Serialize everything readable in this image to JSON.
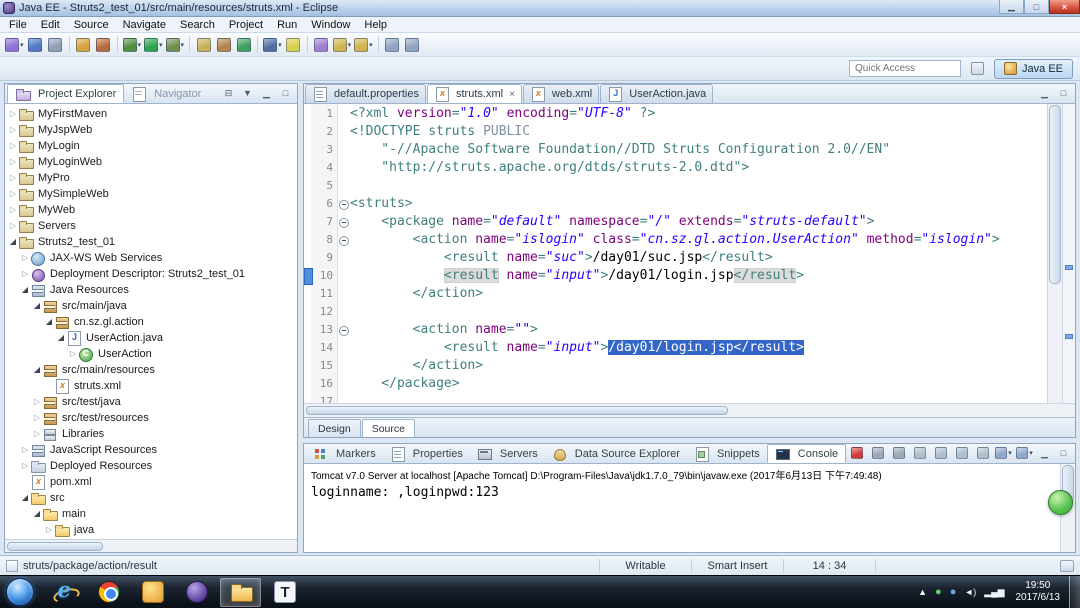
{
  "colors": {
    "syntax-tag": "#3f7f7f",
    "syntax-attr": "#7f007f",
    "syntax-value": "#2a00ff",
    "syntax-doctype": "#3f7f7f",
    "syntax-public": "#7f8fa0",
    "selection-bg": "#3465c8",
    "occurrence-bg": "#dcdcdc",
    "marker-blue": "#4f8fdf",
    "bubble-green": "#3fae3f"
  },
  "titlebar": {
    "title": "Java EE - Struts2_test_01/src/main/resources/struts.xml - Eclipse",
    "window_buttons": [
      "minimize",
      "maximize",
      "close"
    ]
  },
  "menubar": {
    "items": [
      "File",
      "Edit",
      "Source",
      "Navigate",
      "Search",
      "Project",
      "Run",
      "Window",
      "Help"
    ]
  },
  "toolbar": {
    "quick_access_placeholder": "Quick Access",
    "perspective_label": "Java EE",
    "groups": [
      [
        {
          "n": "new",
          "c": "#8e6fd8",
          "dd": true
        },
        {
          "n": "save",
          "c": "#4f79c8"
        },
        {
          "n": "print",
          "c": "#8fa0b4"
        }
      ],
      [
        {
          "n": "new-servlet",
          "c": "#d8a23c"
        },
        {
          "n": "new-ejb",
          "c": "#b86c3c"
        }
      ],
      [
        {
          "n": "debug",
          "c": "#4f8f3f",
          "dd": true
        },
        {
          "n": "run",
          "c": "#2fa44f",
          "dd": true
        },
        {
          "n": "external-tools",
          "c": "#6f8f4f",
          "dd": true
        }
      ],
      [
        {
          "n": "new-java-project",
          "c": "#c8b05a"
        },
        {
          "n": "new-package",
          "c": "#b4824f"
        },
        {
          "n": "new-class",
          "c": "#3fa05f"
        }
      ],
      [
        {
          "n": "search",
          "c": "#4f6f9f",
          "dd": true
        },
        {
          "n": "toggle-mark-occurrences",
          "c": "#d8d04f"
        }
      ],
      [
        {
          "n": "last-edit-location",
          "c": "#9f7fd0"
        },
        {
          "n": "back",
          "c": "#d0b44f",
          "dd": true
        },
        {
          "n": "forward",
          "c": "#d0b44f",
          "dd": true
        }
      ],
      [
        {
          "n": "next-annotation",
          "c": "#8fa4c0"
        },
        {
          "n": "previous-annotation",
          "c": "#8fa4c0"
        }
      ]
    ]
  },
  "explorer": {
    "tab_active": "Project Explorer",
    "tab_inactive": "Navigator",
    "tools": [
      "collapse-all",
      "view-menu",
      "minimize",
      "maximize"
    ],
    "tree": [
      {
        "label": "MyFirstMaven",
        "d": 0,
        "a": "c",
        "icon": "mproject"
      },
      {
        "label": "MyJspWeb",
        "d": 0,
        "a": "c",
        "icon": "wproject"
      },
      {
        "label": "MyLogin",
        "d": 0,
        "a": "c",
        "icon": "wproject"
      },
      {
        "label": "MyLoginWeb",
        "d": 0,
        "a": "c",
        "icon": "wproject"
      },
      {
        "label": "MyPro",
        "d": 0,
        "a": "c",
        "icon": "wproject"
      },
      {
        "label": "MySimpleWeb",
        "d": 0,
        "a": "c",
        "icon": "wproject"
      },
      {
        "label": "MyWeb",
        "d": 0,
        "a": "c",
        "icon": "wproject"
      },
      {
        "label": "Servers",
        "d": 0,
        "a": "c",
        "icon": "sproject"
      },
      {
        "label": "Struts2_test_01",
        "d": 0,
        "a": "e",
        "icon": "wproject"
      },
      {
        "label": "JAX-WS Web Services",
        "d": 1,
        "a": "c",
        "icon": "jaxws"
      },
      {
        "label": "Deployment Descriptor: Struts2_test_01",
        "d": 1,
        "a": "c",
        "icon": "dd"
      },
      {
        "label": "Java Resources",
        "d": 1,
        "a": "e",
        "icon": "jres"
      },
      {
        "label": "src/main/java",
        "d": 2,
        "a": "e",
        "icon": "srcpkg"
      },
      {
        "label": "cn.sz.gl.action",
        "d": 3,
        "a": "e",
        "icon": "pkg"
      },
      {
        "label": "UserAction.java",
        "d": 4,
        "a": "e",
        "icon": "jfile"
      },
      {
        "label": "UserAction",
        "d": 5,
        "a": "c",
        "icon": "cls"
      },
      {
        "label": "src/main/resources",
        "d": 2,
        "a": "e",
        "icon": "srcpkg"
      },
      {
        "label": "struts.xml",
        "d": 3,
        "a": "n",
        "icon": "xfile"
      },
      {
        "label": "src/test/java",
        "d": 2,
        "a": "c",
        "icon": "srcpkg"
      },
      {
        "label": "src/test/resources",
        "d": 2,
        "a": "c",
        "icon": "srcpkg"
      },
      {
        "label": "Libraries",
        "d": 2,
        "a": "c",
        "icon": "lib"
      },
      {
        "label": "JavaScript Resources",
        "d": 1,
        "a": "c",
        "icon": "jsres"
      },
      {
        "label": "Deployed Resources",
        "d": 1,
        "a": "c",
        "icon": "dres"
      },
      {
        "label": "pom.xml",
        "d": 1,
        "a": "n",
        "icon": "xfile"
      },
      {
        "label": "src",
        "d": 1,
        "a": "e",
        "icon": "folder"
      },
      {
        "label": "main",
        "d": 2,
        "a": "e",
        "icon": "folder"
      },
      {
        "label": "java",
        "d": 3,
        "a": "c",
        "icon": "folder"
      }
    ]
  },
  "editor": {
    "tabs": [
      {
        "label": "default.properties",
        "icon": "properties",
        "active": false
      },
      {
        "label": "struts.xml",
        "icon": "xml",
        "active": true
      },
      {
        "label": "web.xml",
        "icon": "xml",
        "active": false
      },
      {
        "label": "UserAction.java",
        "icon": "java",
        "active": false
      }
    ],
    "tools": [
      "minimize",
      "maximize"
    ],
    "view_tabs": [
      "Design",
      "Source"
    ],
    "active_view_tab": "Source",
    "lines": [
      {
        "n": 1,
        "s": [
          [
            "tag",
            "<?xml "
          ],
          [
            "attr",
            "version"
          ],
          [
            "tag",
            "="
          ],
          [
            "val",
            "\"1.0\""
          ],
          [
            "txt",
            " "
          ],
          [
            "attr",
            "encoding"
          ],
          [
            "tag",
            "="
          ],
          [
            "val",
            "\"UTF-8\""
          ],
          [
            "tag",
            " ?>"
          ]
        ]
      },
      {
        "n": 2,
        "s": [
          [
            "tag",
            "<!DOCTYPE struts "
          ],
          [
            "pub",
            "PUBLIC"
          ]
        ]
      },
      {
        "n": 3,
        "s": [
          [
            "dtd",
            "    \"-//Apache Software Foundation//DTD Struts Configuration 2.0//EN\""
          ]
        ]
      },
      {
        "n": 4,
        "s": [
          [
            "dtd",
            "    \"http://struts.apache.org/dtds/struts-2.0.dtd\""
          ],
          [
            "tag",
            ">"
          ]
        ]
      },
      {
        "n": 5,
        "s": []
      },
      {
        "n": 6,
        "f": true,
        "s": [
          [
            "tag",
            "<struts>"
          ]
        ]
      },
      {
        "n": 7,
        "f": true,
        "s": [
          [
            "tag",
            "    <package "
          ],
          [
            "attr",
            "name"
          ],
          [
            "tag",
            "="
          ],
          [
            "val",
            "\"default\""
          ],
          [
            "txt",
            " "
          ],
          [
            "attr",
            "namespace"
          ],
          [
            "tag",
            "="
          ],
          [
            "val",
            "\"/\""
          ],
          [
            "txt",
            " "
          ],
          [
            "attr",
            "extends"
          ],
          [
            "tag",
            "="
          ],
          [
            "val",
            "\"struts-default\""
          ],
          [
            "tag",
            ">"
          ]
        ]
      },
      {
        "n": 8,
        "f": true,
        "s": [
          [
            "tag",
            "        <action "
          ],
          [
            "attr",
            "name"
          ],
          [
            "tag",
            "="
          ],
          [
            "val",
            "\"islogin\""
          ],
          [
            "txt",
            " "
          ],
          [
            "attr",
            "class"
          ],
          [
            "tag",
            "="
          ],
          [
            "val",
            "\"cn.sz.gl.action.UserAction\""
          ],
          [
            "txt",
            " "
          ],
          [
            "attr",
            "method"
          ],
          [
            "tag",
            "="
          ],
          [
            "val",
            "\"islogin\""
          ],
          [
            "tag",
            ">"
          ]
        ]
      },
      {
        "n": 9,
        "s": [
          [
            "tag",
            "            <result "
          ],
          [
            "attr",
            "name"
          ],
          [
            "tag",
            "="
          ],
          [
            "val",
            "\"suc\""
          ],
          [
            "tag",
            ">"
          ],
          [
            "txt",
            "/day01/suc.jsp"
          ],
          [
            "tag",
            "</result>"
          ]
        ]
      },
      {
        "n": 10,
        "m": true,
        "s": [
          [
            "tag",
            "            "
          ],
          [
            "tago",
            "<result"
          ],
          [
            "tag",
            " "
          ],
          [
            "attr",
            "name"
          ],
          [
            "tag",
            "="
          ],
          [
            "val",
            "\"input\""
          ],
          [
            "tag",
            ">"
          ],
          [
            "txt",
            "/day01/login.jsp"
          ],
          [
            "tago",
            "</result"
          ],
          [
            "tag",
            ">"
          ]
        ]
      },
      {
        "n": 11,
        "s": [
          [
            "tag",
            "        </action>"
          ]
        ]
      },
      {
        "n": 12,
        "s": []
      },
      {
        "n": 13,
        "f": true,
        "s": [
          [
            "tag",
            "        <action "
          ],
          [
            "attr",
            "name"
          ],
          [
            "tag",
            "="
          ],
          [
            "val",
            "\"\""
          ],
          [
            "tag",
            ">"
          ]
        ]
      },
      {
        "n": 14,
        "s": [
          [
            "tag",
            "            <result "
          ],
          [
            "attr",
            "name"
          ],
          [
            "tag",
            "="
          ],
          [
            "val",
            "\"input\""
          ],
          [
            "tag",
            ">"
          ],
          [
            "sel",
            "/day01/login.jsp</result>"
          ]
        ]
      },
      {
        "n": 15,
        "s": [
          [
            "tag",
            "        </action>"
          ]
        ]
      },
      {
        "n": 16,
        "s": [
          [
            "tag",
            "    </package>"
          ]
        ]
      },
      {
        "n": 17,
        "s": []
      }
    ]
  },
  "console": {
    "tabs": [
      {
        "label": "Markers",
        "icon": "markers",
        "active": false
      },
      {
        "label": "Properties",
        "icon": "properties",
        "active": false
      },
      {
        "label": "Servers",
        "icon": "servers",
        "active": false
      },
      {
        "label": "Data Source Explorer",
        "icon": "dse",
        "active": false
      },
      {
        "label": "Snippets",
        "icon": "snippets",
        "active": false
      },
      {
        "label": "Console",
        "icon": "console",
        "active": true
      }
    ],
    "tools": [
      {
        "n": "terminate",
        "c": "#d23b3b"
      },
      {
        "n": "remove-launch",
        "c": "#9aa8b8"
      },
      {
        "n": "remove-all-launches",
        "c": "#9aa8b8"
      },
      {
        "n": "clear-console",
        "c": "#aebecc"
      },
      {
        "n": "scroll-lock",
        "c": "#aebecc"
      },
      {
        "n": "word-wrap",
        "c": "#aebecc"
      },
      {
        "n": "pin-console",
        "c": "#aebecc"
      },
      {
        "n": "display-selected-console",
        "c": "#8fa8c8",
        "dd": true
      },
      {
        "n": "open-console",
        "c": "#8fa8c8",
        "dd": true
      }
    ],
    "window_tools": [
      "minimize",
      "maximize"
    ],
    "header_line": "Tomcat v7.0 Server at localhost [Apache Tomcat] D:\\Program-Files\\Java\\jdk1.7.0_79\\bin\\javaw.exe (2017年6月13日 下午7:49:48)",
    "output_line": "loginname: ,loginpwd:123"
  },
  "statusbar": {
    "selection_path": "struts/package/action/result",
    "writable": "Writable",
    "insert_mode": "Smart Insert",
    "caret_position": "14 : 34"
  },
  "taskbar": {
    "apps": [
      {
        "n": "internet-explorer"
      },
      {
        "n": "chrome"
      },
      {
        "n": "yellow-app"
      },
      {
        "n": "purple-app"
      },
      {
        "n": "file-explorer",
        "active": true
      },
      {
        "n": "t-app"
      }
    ],
    "tray": [
      "tray-expand",
      "tray-app-green",
      "tray-app-blue",
      "volume",
      "network"
    ],
    "clock_time": "19:50",
    "clock_date": "2017/6/13"
  }
}
